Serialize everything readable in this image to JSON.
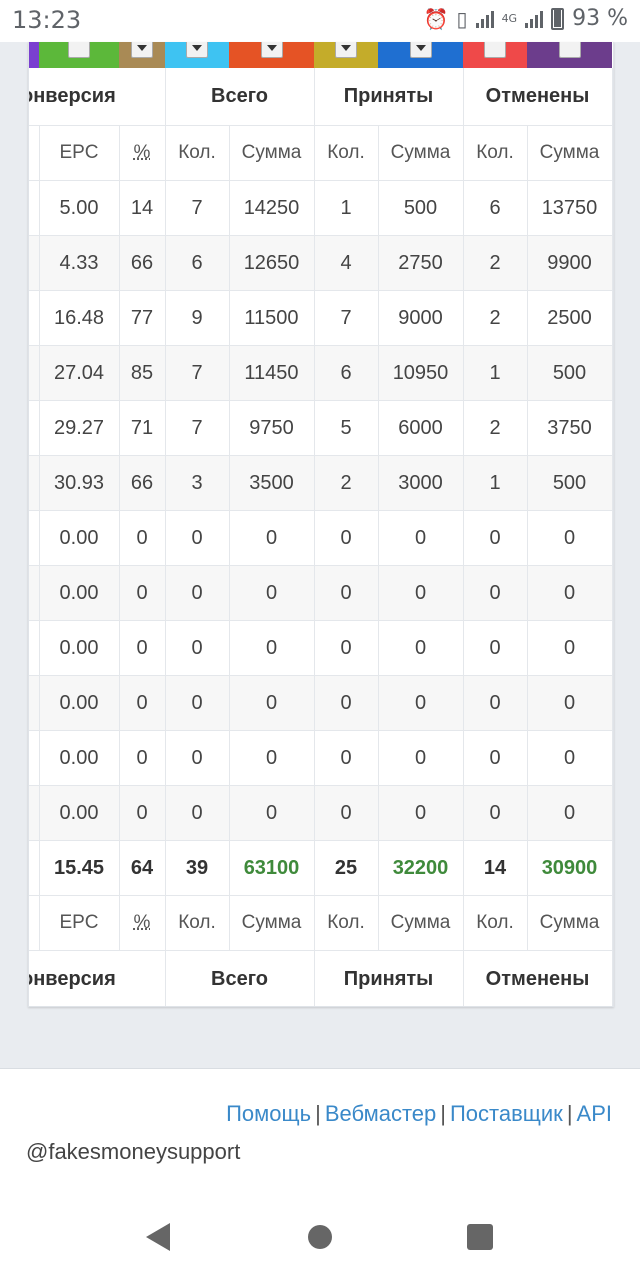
{
  "status": {
    "time": "13:23",
    "battery": "93 %",
    "network": "4G"
  },
  "strip_colors": [
    "#7a3fd0",
    "#5cb83a",
    "#a98a55",
    "#3ec3f2",
    "#e55325",
    "#c4ac2a",
    "#1f6fd1",
    "#ef4949",
    "#6c3d8c"
  ],
  "table": {
    "groups": [
      "онверсия",
      "Всего",
      "Приняты",
      "Отменены"
    ],
    "subheaders": [
      "EPC",
      "%",
      "Кол.",
      "Сумма",
      "Кол.",
      "Сумма",
      "Кол.",
      "Сумма"
    ],
    "rows": [
      [
        "5.00",
        "14",
        "7",
        "14250",
        "1",
        "500",
        "6",
        "13750"
      ],
      [
        "4.33",
        "66",
        "6",
        "12650",
        "4",
        "2750",
        "2",
        "9900"
      ],
      [
        "16.48",
        "77",
        "9",
        "11500",
        "7",
        "9000",
        "2",
        "2500"
      ],
      [
        "27.04",
        "85",
        "7",
        "11450",
        "6",
        "10950",
        "1",
        "500"
      ],
      [
        "29.27",
        "71",
        "7",
        "9750",
        "5",
        "6000",
        "2",
        "3750"
      ],
      [
        "30.93",
        "66",
        "3",
        "3500",
        "2",
        "3000",
        "1",
        "500"
      ],
      [
        "0.00",
        "0",
        "0",
        "0",
        "0",
        "0",
        "0",
        "0"
      ],
      [
        "0.00",
        "0",
        "0",
        "0",
        "0",
        "0",
        "0",
        "0"
      ],
      [
        "0.00",
        "0",
        "0",
        "0",
        "0",
        "0",
        "0",
        "0"
      ],
      [
        "0.00",
        "0",
        "0",
        "0",
        "0",
        "0",
        "0",
        "0"
      ],
      [
        "0.00",
        "0",
        "0",
        "0",
        "0",
        "0",
        "0",
        "0"
      ],
      [
        "0.00",
        "0",
        "0",
        "0",
        "0",
        "0",
        "0",
        "0"
      ]
    ],
    "totals": [
      "15.45",
      "64",
      "39",
      "63100",
      "25",
      "32200",
      "14",
      "30900"
    ]
  },
  "footer": {
    "links": [
      "Помощь",
      "Вебмастер",
      "Поставщик",
      "API"
    ],
    "handle": "@fakesmoneysupport"
  }
}
